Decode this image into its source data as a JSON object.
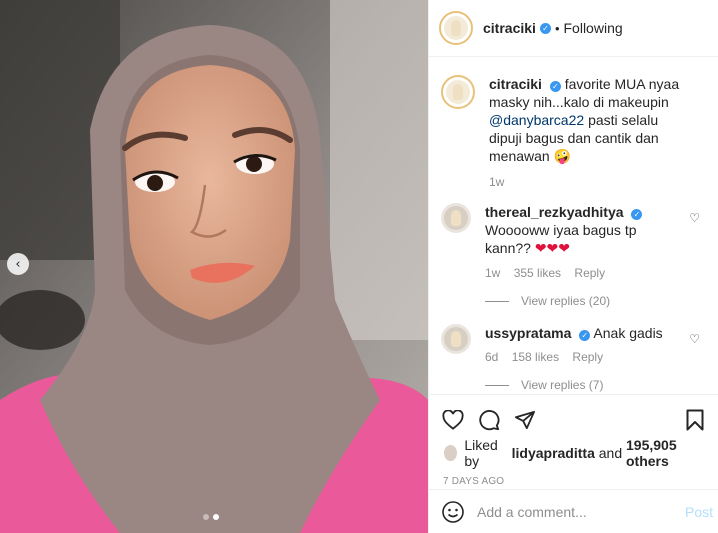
{
  "post": {
    "username": "citraciki",
    "follow_status": "Following",
    "separator": "•",
    "caption": {
      "username": "citraciki",
      "text_before_mention": "favorite MUA nyaa masky nih...kalo di makeupin",
      "mention": "@danybarca22",
      "text_after_mention": "pasti selalu dipuji bagus dan cantik dan menawan",
      "emoji": "🤪",
      "time": "1w"
    },
    "carousel": {
      "prev_icon": "chevron-left-icon",
      "dots": 2,
      "active_dot": 2
    }
  },
  "comments": [
    {
      "username": "thereal_rezkyadhitya",
      "text": "Wooooww iyaa bagus tp kann??",
      "hearts": "❤❤❤",
      "time": "1w",
      "likes": "355 likes",
      "reply_label": "Reply",
      "view_replies": "View replies (20)"
    },
    {
      "username": "ussypratama",
      "text": "Anak gadis",
      "time": "6d",
      "likes": "158 likes",
      "reply_label": "Reply",
      "view_replies": "View replies (7)"
    }
  ],
  "actions": {
    "liked_by_prefix": "Liked by",
    "liked_by_user": "lidyapraditta",
    "liked_by_and": "and",
    "others_count": "195,905 others",
    "date": "7 DAYS AGO"
  },
  "add_comment": {
    "placeholder": "Add a comment...",
    "post_label": "Post"
  },
  "colors": {
    "verified": "#3897f0",
    "link": "#00376b",
    "muted": "#8e8e8e",
    "post_disabled": "#b2dffc",
    "story_ring": "#e8c27a"
  }
}
